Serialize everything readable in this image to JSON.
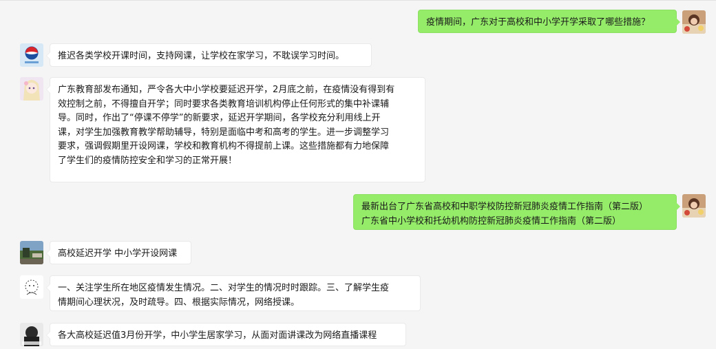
{
  "messages": [
    {
      "sender": "self",
      "avatar": "avatar-self",
      "lines": [
        "疫情期间，广东对于高校和中小学开学采取了哪些措施？"
      ]
    },
    {
      "sender": "other",
      "avatar": "avatar-pepsi-logo",
      "lines": [
        "推迟各类学校开课时间，支持网课，让学校在家学习，不耽误学习时间。"
      ]
    },
    {
      "sender": "other",
      "avatar": "avatar-anime-girl",
      "lines": [
        "广东教育部发布通知，严令各大中小学校要延迟开学，2月底之前，在疫情没有得到有",
        "效控制之前，不得擅自开学；同时要求各类教育培训机构停止任何形式的集中补课辅",
        "导。同时，作出了“停课不停学”的新要求，延迟开学期间，各学校充分利用线上开",
        "课，对学生加强教育教学帮助辅导，特别是面临中考和高考的学生。进一步调整学习",
        "要求，强调假期里开设网课，学校和教育机构不得提前上课。这些措施都有力地保障",
        "了学生们的疫情防控安全和学习的正常开展！"
      ]
    },
    {
      "sender": "self",
      "avatar": "avatar-self",
      "lines": [
        "最新出台了广东省高校和中职学校防控新冠肺炎疫情工作指南（第二版）",
        "广东省中小学校和托幼机构防控新冠肺炎疫情工作指南（第二版）"
      ]
    },
    {
      "sender": "other",
      "avatar": "avatar-landscape-photo",
      "lines": [
        "高校延迟开学 中小学开设网课"
      ]
    },
    {
      "sender": "other",
      "avatar": "avatar-sketch-drawing",
      "lines": [
        "一、关注学生所在地区疫情发生情况。二、对学生的情况时时跟踪。三、了解学生疫",
        "情期间心理状况，及时疏导。四、根据实际情况，网络授课。"
      ]
    },
    {
      "sender": "other",
      "avatar": "avatar-dark-character",
      "lines": [
        "各大高校延迟值3月份开学，中小学生居家学习，从面对面讲课改为网络直播课程"
      ]
    }
  ],
  "colors": {
    "background": "#f5f5f5",
    "incoming_bubble": "#ffffff",
    "outgoing_bubble": "#95ec69"
  }
}
